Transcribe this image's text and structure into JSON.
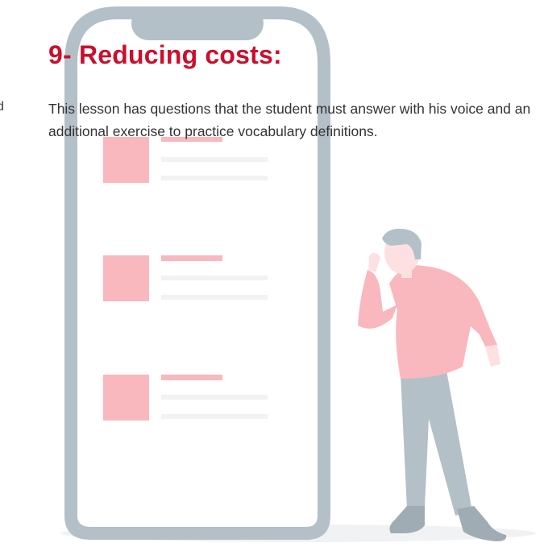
{
  "clipped_left_text": "d",
  "lesson": {
    "title": "9- Reducing costs:",
    "description": "This lesson has questions that the student must answer with his voice and an additional exercise to practice vocabulary definitions."
  },
  "colors": {
    "title": "#c8102e",
    "phone_frame": "#b4c0c8",
    "accent_pink": "#f9b8be",
    "placeholder_line": "#f1f2f3"
  }
}
